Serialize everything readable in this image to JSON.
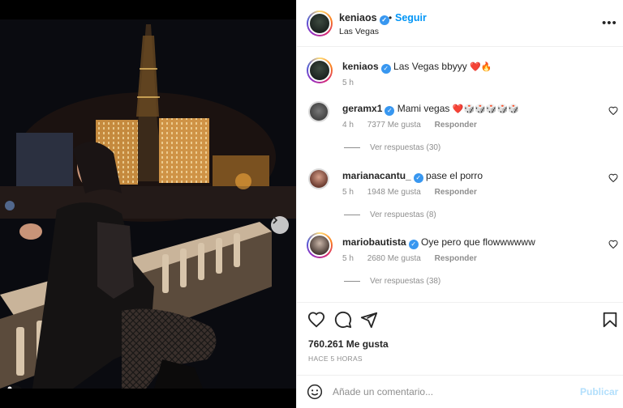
{
  "post": {
    "username": "keniaos",
    "follow_label": "Seguir",
    "separator": "•",
    "location": "Las Vegas",
    "more_icon": "more-horizontal-icon",
    "caption": "Las Vegas bbyyy",
    "caption_emoji": "❤️🔥",
    "caption_age": "5 h"
  },
  "comments": [
    {
      "username": "geramx1",
      "verified": true,
      "text": "Mami vegas",
      "emoji": "❤️🎲🎲🎲🎲🎲",
      "age": "4 h",
      "likes": "7377 Me gusta",
      "reply_label": "Responder",
      "view_replies": "Ver respuestas (30)"
    },
    {
      "username": "marianacantu_",
      "verified": true,
      "text": "pase el porro",
      "emoji": "",
      "age": "5 h",
      "likes": "1948 Me gusta",
      "reply_label": "Responder",
      "view_replies": "Ver respuestas (8)"
    },
    {
      "username": "mariobautista",
      "verified": true,
      "text": "Oye pero que flowwwwww",
      "emoji": "",
      "age": "5 h",
      "likes": "2680 Me gusta",
      "reply_label": "Responder",
      "view_replies": "Ver respuestas (38)"
    }
  ],
  "actions": {
    "like_icon": "heart-icon",
    "comment_icon": "comment-icon",
    "share_icon": "send-icon",
    "save_icon": "bookmark-icon",
    "likes_count": "760.261 Me gusta",
    "time_ago": "HACE 5 HORAS"
  },
  "composer": {
    "placeholder": "Añade un comentario...",
    "publish_label": "Publicar"
  },
  "carousel": {
    "current": 1,
    "total": 6
  },
  "colors": {
    "accent": "#0095f6",
    "verified": "#3897f0",
    "heart": "#ed4956",
    "muted": "#8e8e8e"
  }
}
